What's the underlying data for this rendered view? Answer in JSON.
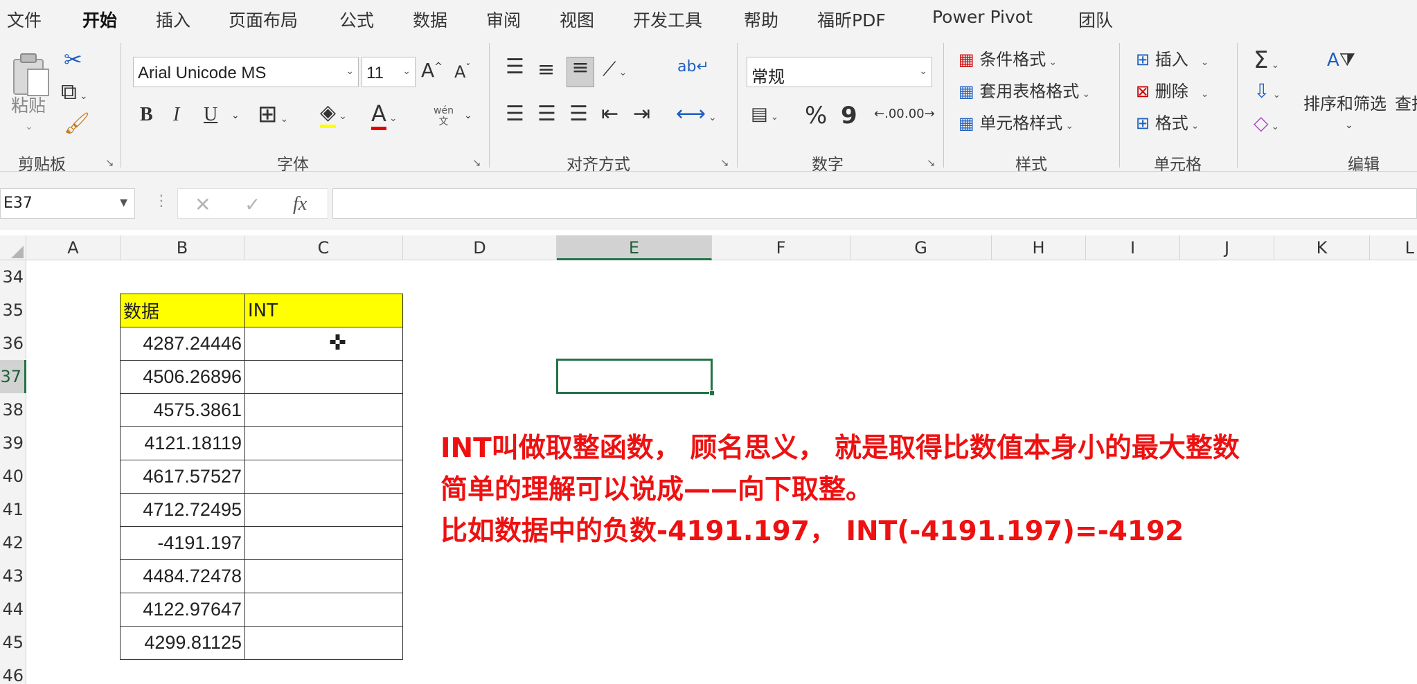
{
  "menu": {
    "tabs": [
      "文件",
      "开始",
      "插入",
      "页面布局",
      "公式",
      "数据",
      "审阅",
      "视图",
      "开发工具",
      "帮助",
      "福昕PDF",
      "Power Pivot",
      "团队"
    ],
    "active": "开始"
  },
  "ribbon": {
    "clipboard": {
      "paste_label": "粘贴",
      "group_label": "剪贴板"
    },
    "font": {
      "font_name": "Arial Unicode MS",
      "font_size": "11",
      "grow": "A",
      "shrink": "A",
      "bold": "B",
      "italic": "I",
      "underline": "U",
      "phonetic": "wén\n文",
      "group_label": "字体"
    },
    "alignment": {
      "group_label": "对齐方式"
    },
    "number": {
      "format": "常规",
      "percent": "%",
      "comma": "9",
      "inc_decimal": ".00",
      "dec_decimal": ".00",
      "group_label": "数字"
    },
    "styles": {
      "conditional": "条件格式",
      "table_format": "套用表格格式",
      "cell_styles": "单元格样式",
      "group_label": "样式"
    },
    "cells": {
      "insert": "插入",
      "delete": "删除",
      "format": "格式",
      "group_label": "单元格"
    },
    "editing": {
      "sort_filter": "排序和筛选",
      "find": "查找",
      "group_label": "编辑"
    }
  },
  "formula_bar": {
    "name_box": "E37",
    "formula": "",
    "fx": "fx"
  },
  "columns": [
    "A",
    "B",
    "C",
    "D",
    "E",
    "F",
    "G",
    "H",
    "I",
    "J",
    "K",
    "L"
  ],
  "selected_column": "E",
  "rows": [
    "34",
    "35",
    "36",
    "37",
    "38",
    "39",
    "40",
    "41",
    "42",
    "43",
    "44",
    "45",
    "46"
  ],
  "selected_row": "37",
  "table": {
    "headers": [
      "数据",
      "INT"
    ],
    "values": [
      "4287.24446",
      "4506.26896",
      "4575.3861",
      "4121.18119",
      "4617.57527",
      "4712.72495",
      "-4191.197",
      "4484.72478",
      "4122.97647",
      "4299.81125"
    ]
  },
  "annotation": {
    "line1": "INT叫做取整函数， 顾名思义， 就是取得比数值本身小的最大整数",
    "line2": "简单的理解可以说成——向下取整。",
    "line3": "比如数据中的负数-4191.197， INT(-4191.197)=-4192",
    "color": "#ee1111"
  },
  "colors": {
    "accent": "#217346",
    "header_fill": "#ffff00"
  }
}
